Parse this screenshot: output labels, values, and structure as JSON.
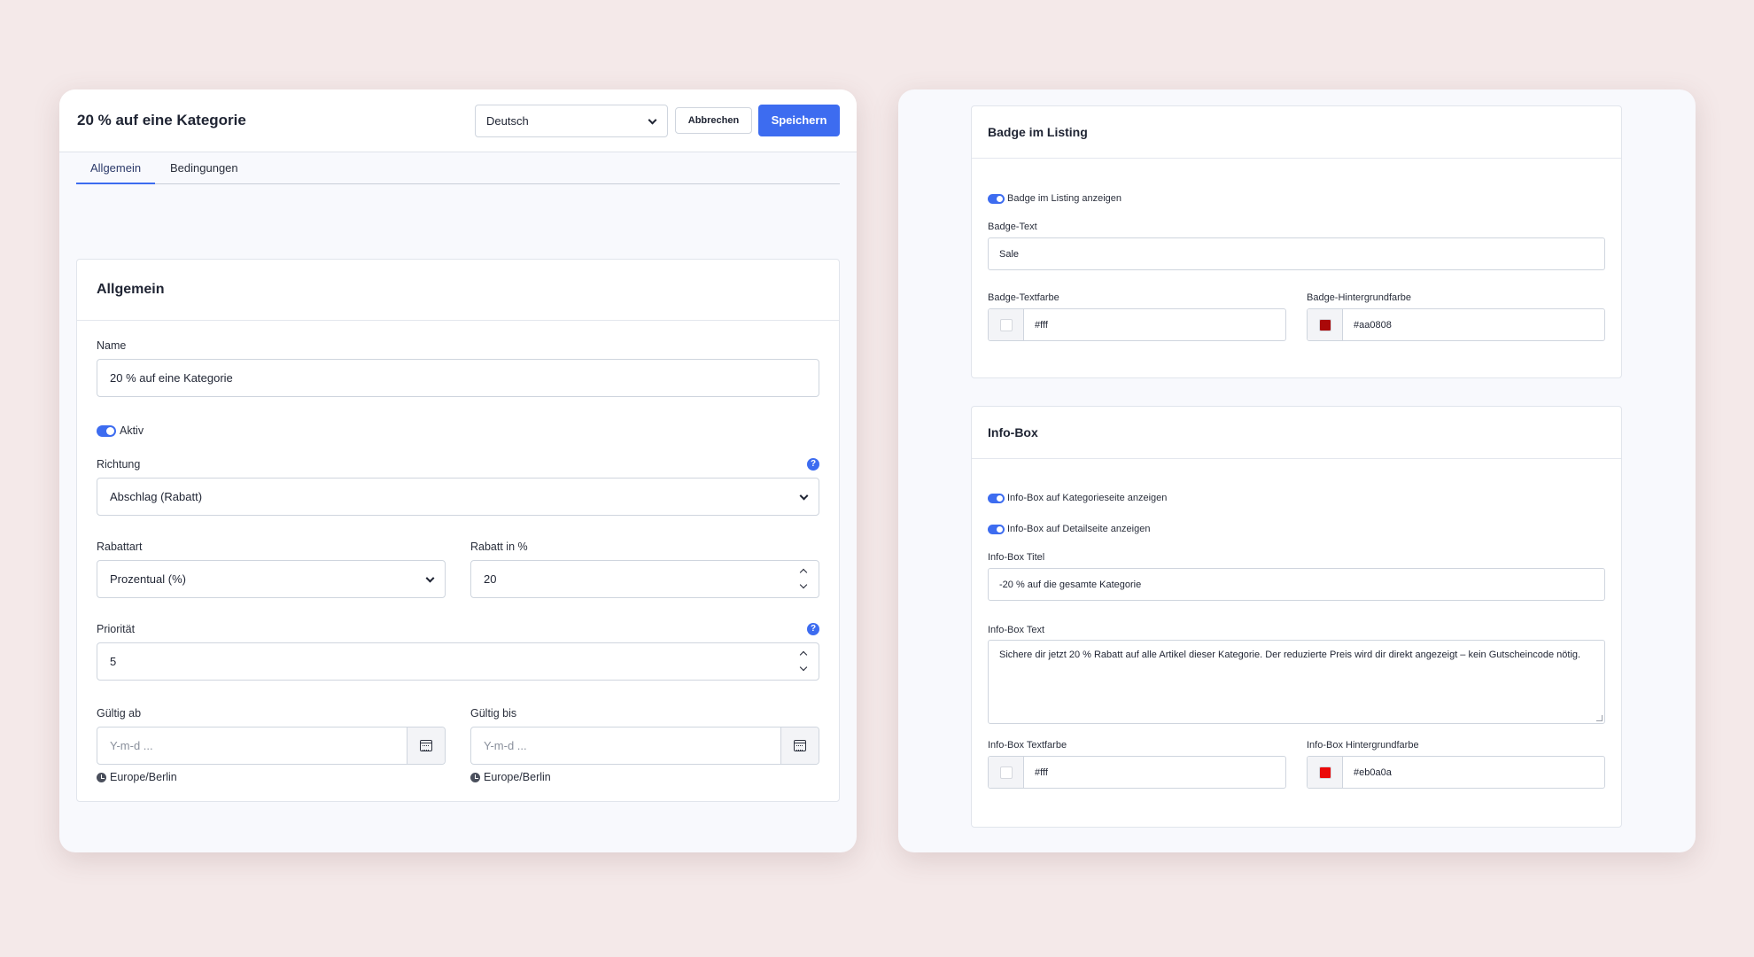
{
  "left": {
    "header": {
      "title": "20 % auf eine Kategorie",
      "language": "Deutsch",
      "cancel_label": "Abbrechen",
      "save_label": "Speichern"
    },
    "tabs": [
      {
        "label": "Allgemein",
        "active": true
      },
      {
        "label": "Bedingungen",
        "active": false
      }
    ],
    "card": {
      "title": "Allgemein",
      "name_label": "Name",
      "name_value": "20 % auf eine Kategorie",
      "active_label": "Aktiv",
      "active_on": true,
      "richtung_label": "Richtung",
      "richtung_value": "Abschlag (Rabatt)",
      "help_glyph": "?",
      "rabattart_label": "Rabattart",
      "rabattart_value": "Prozentual (%)",
      "rabatt_label": "Rabatt in %",
      "rabatt_value": "20",
      "prioritaet_label": "Priorität",
      "prioritaet_value": "5",
      "gueltig_ab_label": "Gültig ab",
      "gueltig_bis_label": "Gültig bis",
      "date_placeholder": "Y-m-d ...",
      "timezone": "Europe/Berlin"
    }
  },
  "right": {
    "badge": {
      "title": "Badge im Listing",
      "toggle_label": "Badge im Listing anzeigen",
      "toggle_on": true,
      "text_label": "Badge-Text",
      "text_value": "Sale",
      "textcolor_label": "Badge-Textfarbe",
      "textcolor_value": "#fff",
      "bgcolor_label": "Badge-Hintergrundfarbe",
      "bgcolor_value": "#aa0808"
    },
    "infobox": {
      "title": "Info-Box",
      "toggle_category_label": "Info-Box auf Kategorieseite anzeigen",
      "toggle_detail_label": "Info-Box auf Detailseite anzeigen",
      "title_label": "Info-Box Titel",
      "title_value": "-20 % auf die gesamte Kategorie",
      "text_label": "Info-Box Text",
      "text_value": "Sichere dir jetzt 20 % Rabatt auf alle Artikel dieser Kategorie. Der reduzierte Preis wird dir direkt angezeigt – kein Gutscheincode nötig.",
      "textcolor_label": "Info-Box Textfarbe",
      "textcolor_value": "#fff",
      "bgcolor_label": "Info-Box Hintergrundfarbe",
      "bgcolor_value": "#eb0a0a"
    }
  },
  "colors": {
    "accent": "#3d6cf0",
    "background": "#f4e9e9"
  }
}
